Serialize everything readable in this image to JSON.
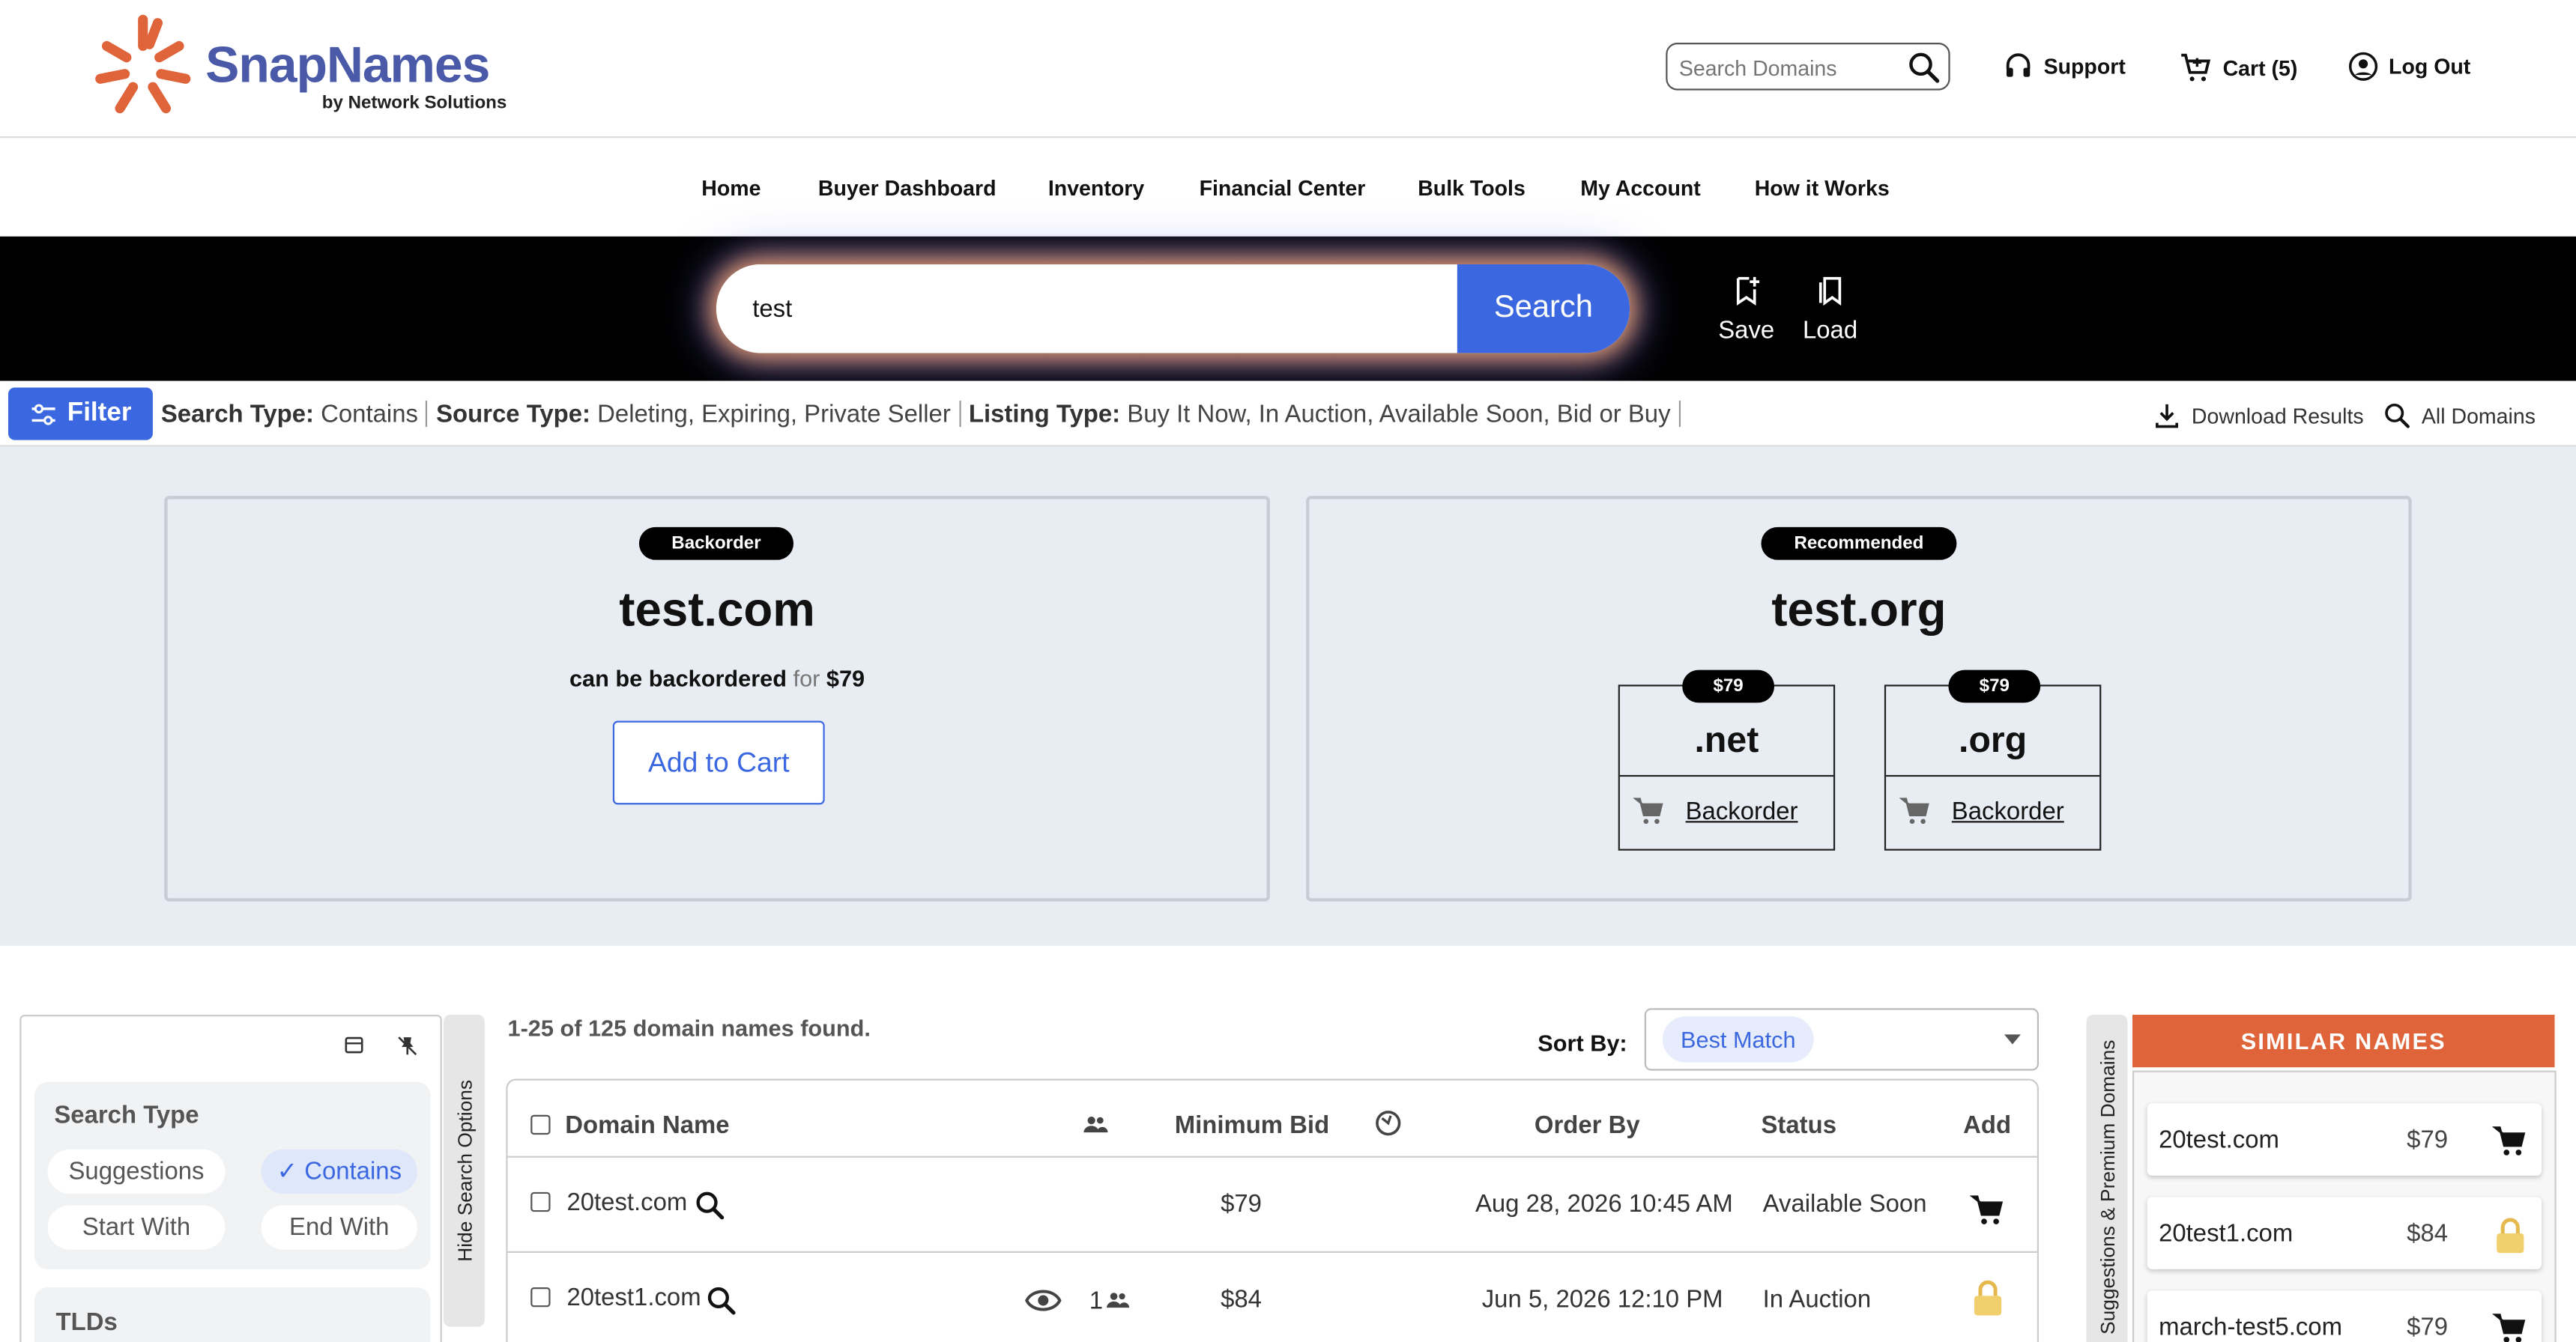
{
  "header": {
    "logo_name": "SnapNames",
    "logo_sub": "by Network Solutions",
    "search_placeholder": "Search Domains",
    "support_label": "Support",
    "cart_label": "Cart (5)",
    "logout_label": "Log Out"
  },
  "nav": {
    "items": [
      "Home",
      "Buyer Dashboard",
      "Inventory",
      "Financial Center",
      "Bulk Tools",
      "My Account",
      "How it Works"
    ]
  },
  "hero": {
    "search_value": "test",
    "search_button": "Search",
    "save_label": "Save",
    "load_label": "Load"
  },
  "filterbar": {
    "filter_label": "Filter",
    "search_type_label": "Search Type:",
    "search_type_value": "Contains",
    "source_type_label": "Source Type:",
    "source_type_value": "Deleting, Expiring, Private Seller",
    "listing_type_label": "Listing Type:",
    "listing_type_value": "Buy It Now, In Auction, Available Soon, Bid or Buy",
    "download_label": "Download Results",
    "all_domains_label": "All Domains"
  },
  "featured": {
    "left": {
      "badge": "Backorder",
      "domain": "test.com",
      "line_bold": "can be backordered",
      "line_for": "for",
      "price": "$79",
      "button": "Add to Cart"
    },
    "right": {
      "badge": "Recommended",
      "domain": "test.org",
      "tlds": [
        {
          "price": "$79",
          "tld": ".net",
          "action": "Backorder"
        },
        {
          "price": "$79",
          "tld": ".org",
          "action": "Backorder"
        }
      ]
    }
  },
  "left_panel": {
    "search_type_title": "Search Type",
    "options": [
      "Suggestions",
      "Contains",
      "Start With",
      "End With"
    ],
    "selected": "Contains",
    "tlds_title": "TLDs",
    "hide_tab": "Hide Search Options"
  },
  "results": {
    "count_text": "1-25 of 125 domain names found.",
    "sort_label": "Sort By:",
    "sort_value": "Best Match",
    "columns": {
      "domain": "Domain Name",
      "min_bid": "Minimum Bid",
      "order_by": "Order By",
      "status": "Status",
      "add": "Add"
    },
    "rows": [
      {
        "domain": "20test.com",
        "watchers": "",
        "min_bid": "$79",
        "order_by": "Aug 28, 2026 10:45 AM",
        "status": "Available Soon",
        "action_icon": "cart-icon"
      },
      {
        "domain": "20test1.com",
        "watchers": "1",
        "min_bid": "$84",
        "order_by": "Jun 5, 2026 12:10 PM",
        "status": "In Auction",
        "action_icon": "lock-icon"
      }
    ]
  },
  "right_panel": {
    "tab_label": "Suggestions & Premium Domains",
    "title": "SIMILAR NAMES",
    "items": [
      {
        "name": "20test.com",
        "price": "$79",
        "icon": "cart-icon"
      },
      {
        "name": "20test1.com",
        "price": "$84",
        "icon": "lock-icon"
      },
      {
        "name": "march-test5.com",
        "price": "$79",
        "icon": "cart-icon"
      }
    ]
  },
  "colors": {
    "brand_blue": "#3b68e0",
    "logo_orange": "#e0643a",
    "logo_navy": "#4a5aa8",
    "hero_bg": "#000000",
    "featured_bg": "#e8ecf3"
  }
}
